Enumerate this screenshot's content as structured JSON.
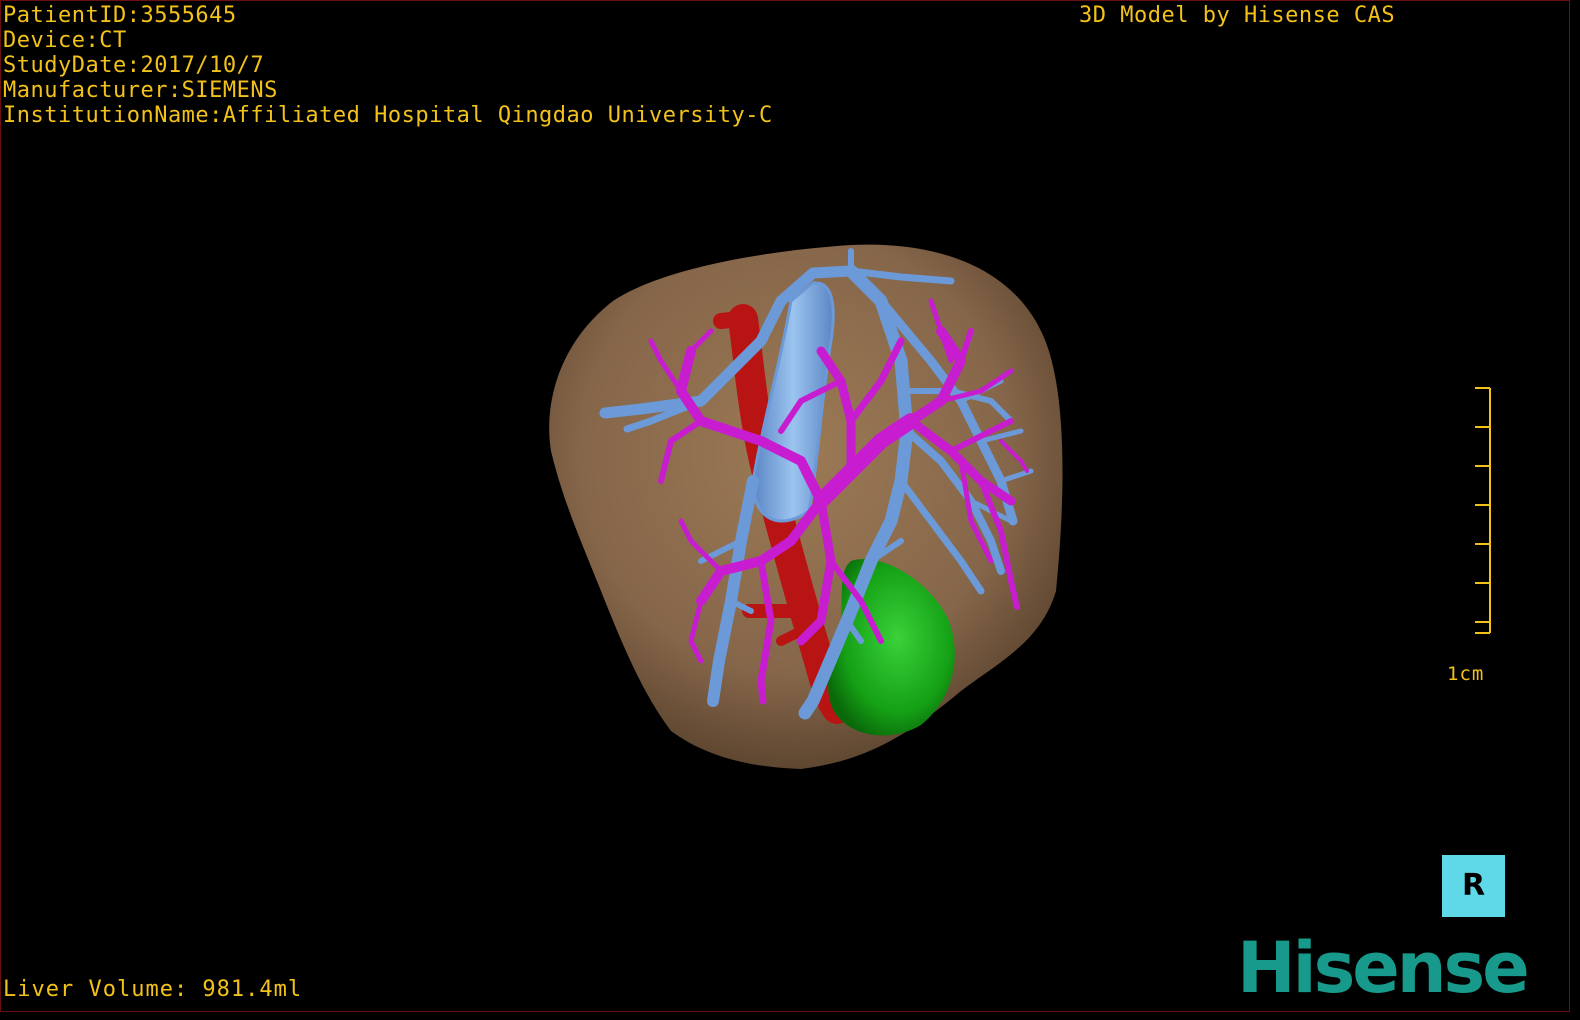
{
  "header": {
    "patient_id": "PatientID:3555645",
    "device": "Device:CT",
    "study_date": "StudyDate:2017/10/7",
    "manufacturer": "Manufacturer:SIEMENS",
    "institution": "InstitutionName:Affiliated Hospital Qingdao University-C",
    "model_credit": "3D Model by Hisense CAS"
  },
  "footer": {
    "liver_volume": "Liver Volume: 981.4ml",
    "logo": "Hisense"
  },
  "scale": {
    "label": "1cm"
  },
  "orientation": {
    "label": "R",
    "icon": "orientation-cube-icon"
  },
  "colors": {
    "overlay_text": "#f2c21a",
    "liver": "#8a6a48",
    "portal_vein": "#c81cd0",
    "hepatic_vein": "#6c9ad8",
    "artery": "#b81414",
    "gallbladder": "#14a014",
    "orientation_cube": "#5fd8e8",
    "logo": "#179a8c"
  }
}
